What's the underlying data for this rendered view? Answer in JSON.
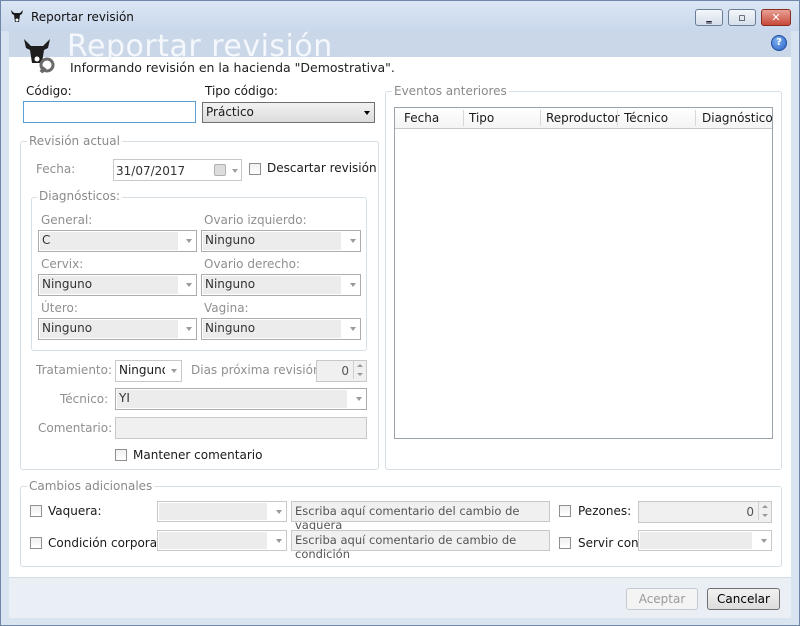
{
  "window": {
    "title": "Reportar revisión"
  },
  "header": {
    "title": "Reportar revisión",
    "subtitle": "Informando revisión en la hacienda \"Demostrativa\".",
    "help_glyph": "?"
  },
  "codigo": {
    "label": "Código:",
    "value": ""
  },
  "tipo_codigo": {
    "label": "Tipo código:",
    "value": "Práctico"
  },
  "revision": {
    "group_title": "Revisión actual",
    "fecha_label": "Fecha:",
    "fecha_value": "31/07/2017",
    "descartar_label": "Descartar revisión",
    "diag_title": "Diagnósticos:",
    "general_label": "General:",
    "general_value": "C",
    "ovario_izq_label": "Ovario izquierdo:",
    "ovario_izq_value": "Ninguno",
    "cervix_label": "Cervix:",
    "cervix_value": "Ninguno",
    "ovario_der_label": "Ovario derecho:",
    "ovario_der_value": "Ninguno",
    "utero_label": "Útero:",
    "utero_value": "Ninguno",
    "vagina_label": "Vagina:",
    "vagina_value": "Ninguno",
    "tratamiento_label": "Tratamiento:",
    "tratamiento_value": "Ninguno",
    "dias_label": "Dias próxima revisión:",
    "dias_value": "0",
    "tecnico_label": "Técnico:",
    "tecnico_value": "YI",
    "comentario_label": "Comentario:",
    "comentario_value": "",
    "mantener_label": "Mantener comentario"
  },
  "eventos": {
    "group_title": "Eventos anteriores",
    "columns": [
      "Fecha",
      "Tipo",
      "Reproductor",
      "Técnico",
      "Diagnóstico"
    ]
  },
  "cambios": {
    "group_title": "Cambios adicionales",
    "vaquera_label": "Vaquera:",
    "vaquera_comment": "Escriba aquí comentario del cambio de vaquera",
    "condicion_label": "Condición corporal:",
    "condicion_comment": "Escriba aquí comentario de cambio de condición",
    "pezones_label": "Pezones:",
    "pezones_value": "0",
    "servir_label": "Servir con:"
  },
  "footer": {
    "accept_label": "Aceptar",
    "cancel_label": "Cancelar"
  },
  "colors": {
    "accent": "#5aa0d8",
    "title_band": "#cad7e8",
    "close": "#c74a3a"
  },
  "icons": {
    "app": "cow-head-icon",
    "header": "cow-wrench-icon",
    "help": "help-icon"
  }
}
